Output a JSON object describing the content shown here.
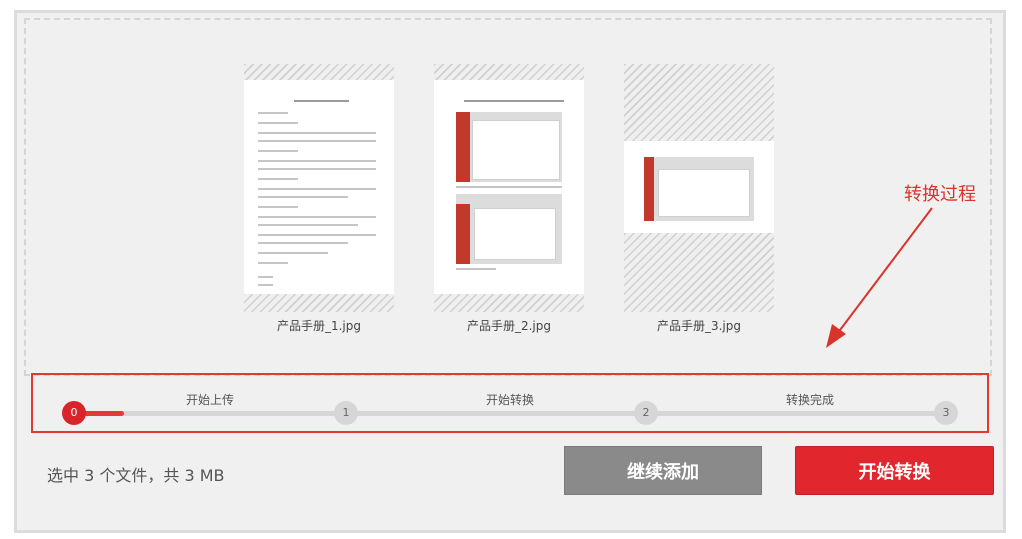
{
  "files": [
    {
      "name": "产品手册_1.jpg"
    },
    {
      "name": "产品手册_2.jpg"
    },
    {
      "name": "产品手册_3.jpg"
    }
  ],
  "annotation": {
    "label": "转换过程"
  },
  "progress": {
    "current_step": 0,
    "nodes": [
      "0",
      "1",
      "2",
      "3"
    ],
    "stages": [
      "开始上传",
      "开始转换",
      "转换完成"
    ]
  },
  "footer": {
    "summary": "选中 3 个文件，共 3 MB",
    "continue_label": "继续添加",
    "start_label": "开始转换"
  },
  "colors": {
    "accent": "#e2262e",
    "secondary": "#8a8a8a"
  }
}
